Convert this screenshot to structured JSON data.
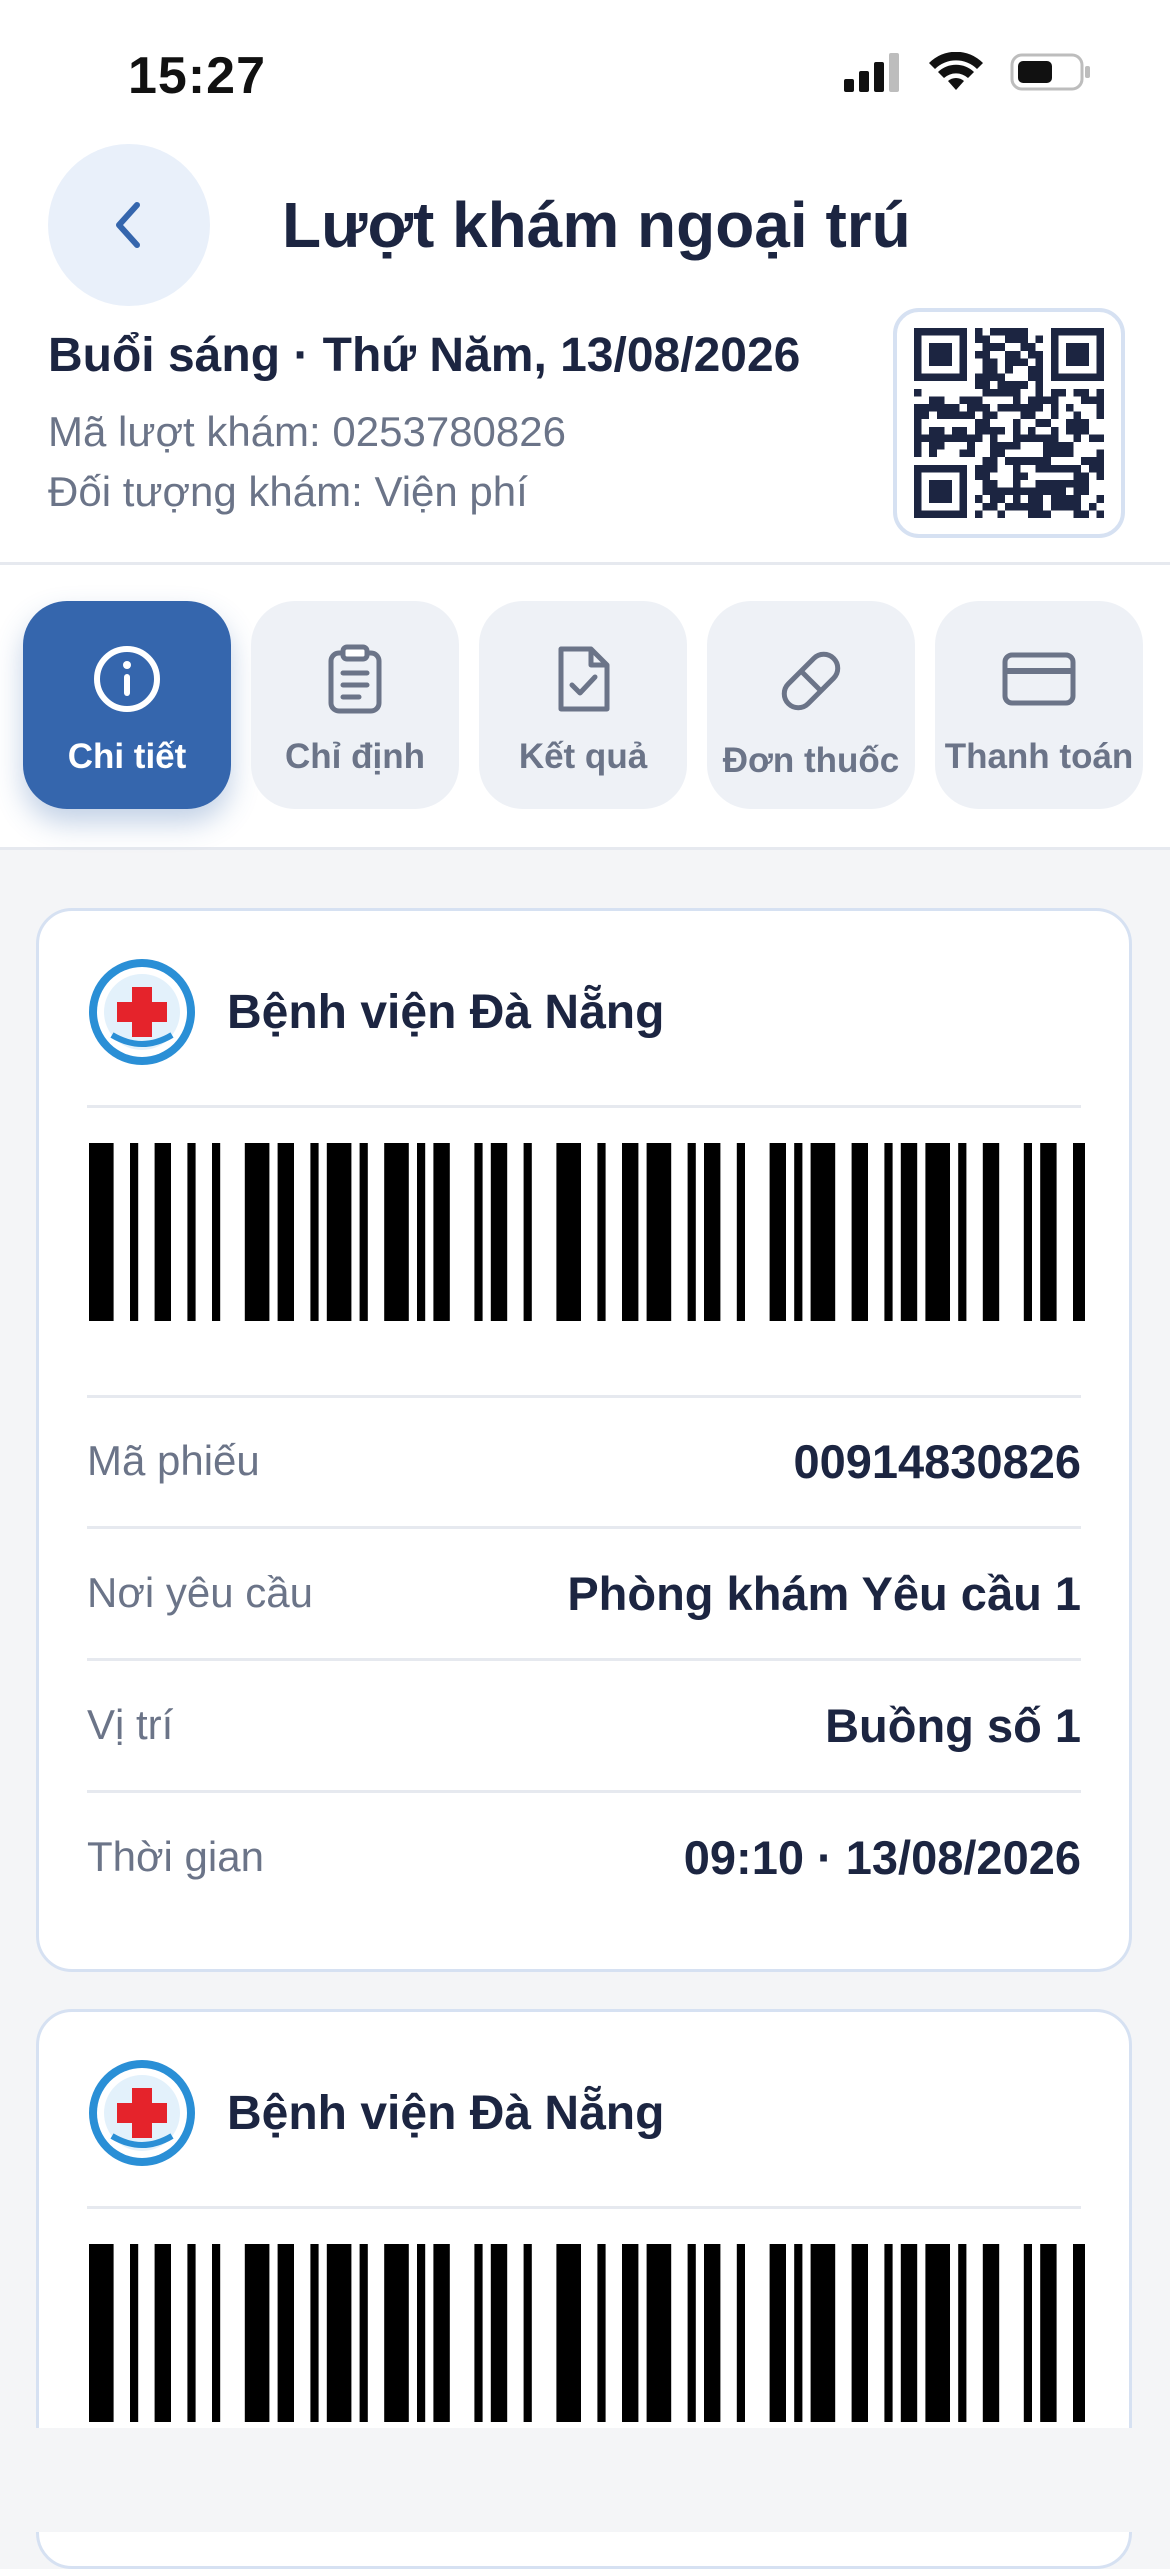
{
  "status_bar": {
    "time": "15:27"
  },
  "header": {
    "title": "Lượt khám ngoại trú",
    "session": "Buổi sáng · Thứ Năm, 13/08/2026",
    "visit_code": "Mã lượt khám: 0253780826",
    "patient_type": "Đối tượng khám: Viện phí"
  },
  "tabs": [
    {
      "label": "Chi tiết",
      "icon": "info-icon",
      "active": true
    },
    {
      "label": "Chỉ định",
      "icon": "clipboard-icon",
      "active": false
    },
    {
      "label": "Kết quả",
      "icon": "file-check-icon",
      "active": false
    },
    {
      "label": "Đơn thuốc",
      "icon": "pill-icon",
      "active": false
    },
    {
      "label": "Thanh toán",
      "icon": "credit-card-icon",
      "active": false
    }
  ],
  "cards": [
    {
      "hospital": "Bệnh viện Đà Nẵng",
      "rows": [
        {
          "label": "Mã phiếu",
          "value": "00914830826"
        },
        {
          "label": "Nơi yêu cầu",
          "value": "Phòng khám Yêu cầu 1"
        },
        {
          "label": "Vị trí",
          "value": "Buồng số 1"
        },
        {
          "label": "Thời gian",
          "value": "09:10 · 13/08/2026"
        }
      ]
    },
    {
      "hospital": "Bệnh viện Đà Nẵng"
    }
  ],
  "colors": {
    "accent": "#3566ad",
    "text_primary": "#1c2541",
    "text_secondary": "#6b7488",
    "card_border": "#d6e1f2",
    "hospital_red": "#e5232b",
    "hospital_blue": "#2a8fd6"
  }
}
